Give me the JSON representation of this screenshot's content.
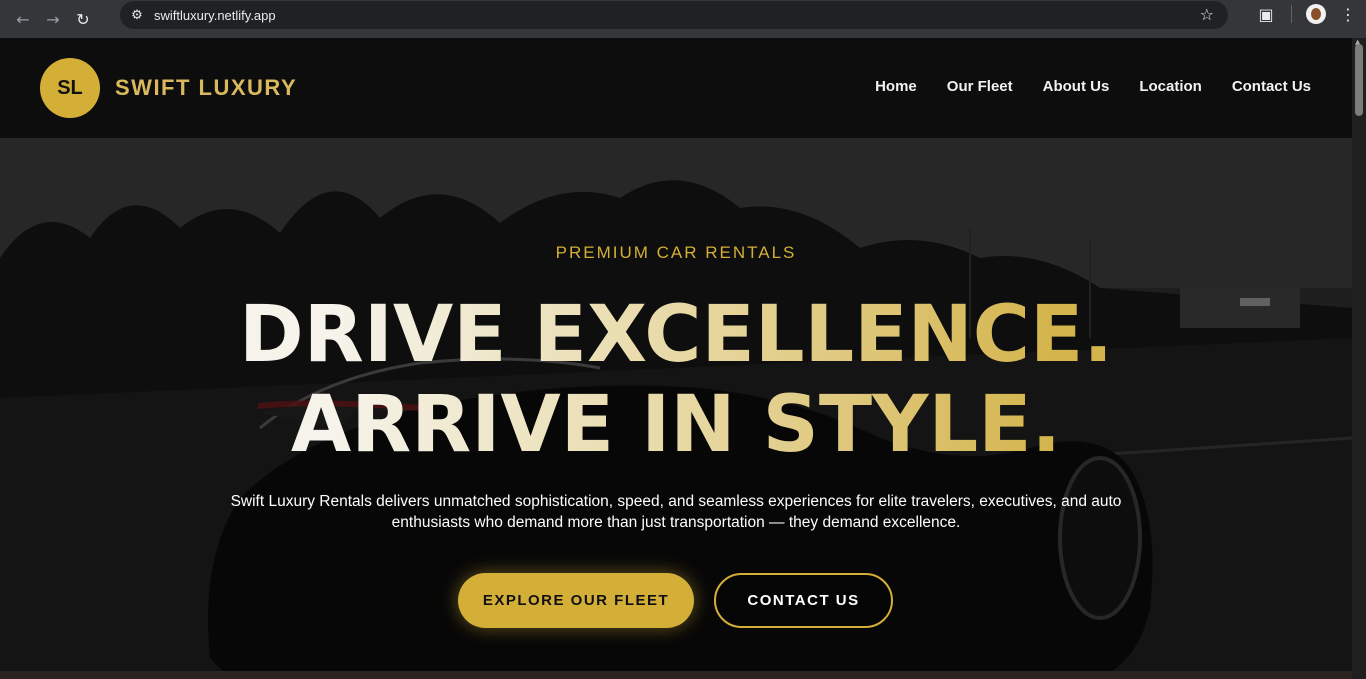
{
  "browser": {
    "url": "swiftluxury.netlify.app",
    "icons": [
      "back-arrow-icon",
      "forward-arrow-icon",
      "reload-icon",
      "site-settings-icon",
      "bookmark-star-icon",
      "extensions-icon",
      "profile-avatar",
      "kebab-menu-icon"
    ]
  },
  "header": {
    "logo_initials": "SL",
    "brand_name": "SWIFT LUXURY",
    "nav": [
      {
        "label": "Home"
      },
      {
        "label": "Our Fleet"
      },
      {
        "label": "About Us"
      },
      {
        "label": "Location"
      },
      {
        "label": "Contact Us"
      }
    ]
  },
  "hero": {
    "eyebrow": "PREMIUM CAR RENTALS",
    "headline_line1": "DRIVE EXCELLENCE.",
    "headline_line2": "ARRIVE IN STYLE.",
    "description_line1": "Swift Luxury Rentals delivers unmatched sophistication, speed, and seamless experiences for elite travelers, executives, and auto",
    "description_line2": "enthusiasts who demand more than just transportation — they demand excellence.",
    "primary_button": "EXPLORE OUR FLEET",
    "secondary_button": "CONTACT US"
  },
  "colors": {
    "accent_gold": "#d4af37",
    "header_bg": "#0d0d0d",
    "text_light": "#ffffff"
  }
}
